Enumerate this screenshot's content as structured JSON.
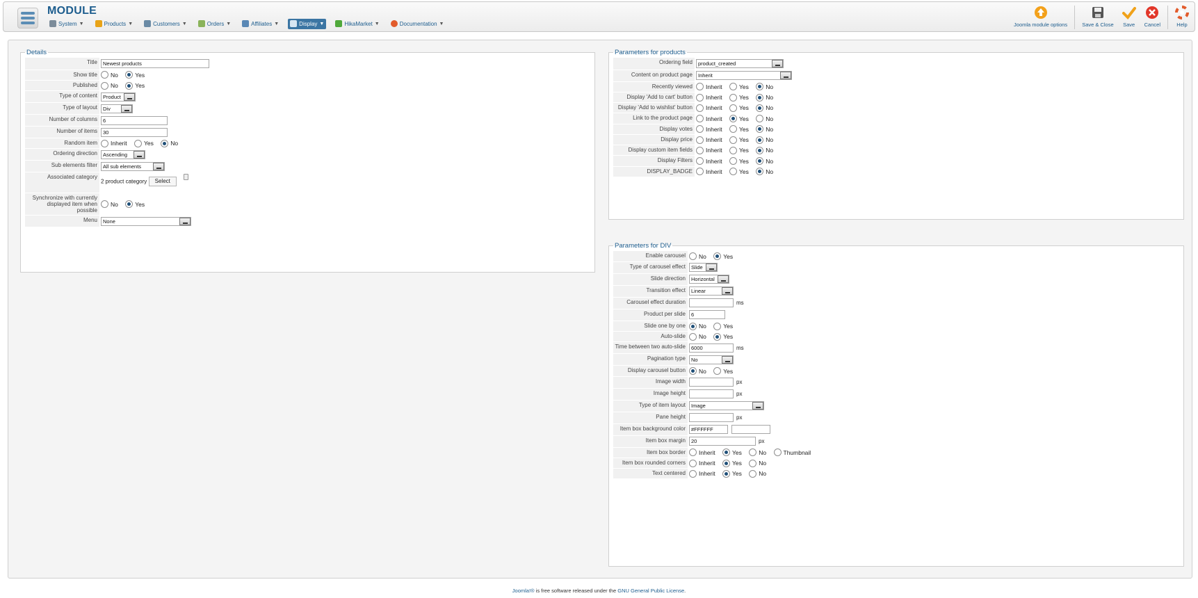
{
  "header": {
    "module_title": "MODULE",
    "menu": [
      {
        "label": "System",
        "icon": "wrench-icon",
        "color": "#7c8c9a"
      },
      {
        "label": "Products",
        "icon": "products-icon",
        "color": "#e8a317"
      },
      {
        "label": "Customers",
        "icon": "customers-icon",
        "color": "#6a8aa5"
      },
      {
        "label": "Orders",
        "icon": "orders-icon",
        "color": "#8ab35a"
      },
      {
        "label": "Affiliates",
        "icon": "affiliates-icon",
        "color": "#5a88b5"
      },
      {
        "label": "Display",
        "icon": "display-icon",
        "color": "#d8e6f2",
        "active": true
      },
      {
        "label": "HikaMarket",
        "icon": "hikamarket-icon",
        "color": "#4fa83a"
      },
      {
        "label": "Documentation",
        "icon": "lifebuoy-icon",
        "color": "#e25b2b"
      }
    ],
    "toolbar": {
      "joomla_options": "Joomla module options",
      "save_close": "Save & Close",
      "save": "Save",
      "cancel": "Cancel",
      "help": "Help"
    }
  },
  "details": {
    "legend": "Details",
    "title_label": "Title",
    "title_value": "Newest products",
    "show_title_label": "Show title",
    "published_label": "Published",
    "type_content_label": "Type of content",
    "type_content_value": "Product",
    "type_layout_label": "Type of layout",
    "type_layout_value": "Div",
    "num_columns_label": "Number of columns",
    "num_columns_value": "6",
    "num_items_label": "Number of items",
    "num_items_value": "30",
    "random_label": "Random item",
    "ordering_dir_label": "Ordering direction",
    "ordering_dir_value": "Ascending",
    "sub_filter_label": "Sub elements filter",
    "sub_filter_value": "All sub elements",
    "assoc_cat_label": "Associated category",
    "assoc_cat_value": "2 product category",
    "select_btn": "Select",
    "sync_label": "Synchronize with currently displayed item when possible",
    "menu_label": "Menu",
    "menu_value": "None"
  },
  "opts": {
    "no": "No",
    "yes": "Yes",
    "inherit": "Inherit",
    "thumbnail": "Thumbnail",
    "ms": "ms",
    "px": "px"
  },
  "products": {
    "legend": "Parameters for products",
    "ordering_field_label": "Ordering field",
    "ordering_field_value": "product_created",
    "content_page_label": "Content on product page",
    "content_page_value": "Inherit",
    "recently_viewed_label": "Recently viewed",
    "add_cart_label": "Display 'Add to cart' button",
    "add_wishlist_label": "Display 'Add to wishlist' button",
    "link_product_label": "Link to the product page",
    "votes_label": "Display votes",
    "price_label": "Display price",
    "custom_fields_label": "Display custom item fields",
    "filters_label": "Display Filters",
    "badge_label": "DISPLAY_BADGE"
  },
  "div": {
    "legend": "Parameters for DIV",
    "enable_carousel_label": "Enable carousel",
    "carousel_effect_label": "Type of carousel effect",
    "carousel_effect_value": "Slide",
    "slide_dir_label": "Slide direction",
    "slide_dir_value": "Horizontal",
    "transition_label": "Transition effect",
    "transition_value": "Linear",
    "duration_label": "Carousel effect duration",
    "duration_value": "",
    "per_slide_label": "Product per slide",
    "per_slide_value": "6",
    "one_by_one_label": "Slide one by one",
    "auto_slide_label": "Auto-slide",
    "time_between_label": "Time between two auto-slide",
    "time_between_value": "6000",
    "pagination_label": "Pagination type",
    "pagination_value": "No",
    "carousel_btn_label": "Display carousel button",
    "img_width_label": "Image width",
    "img_width_value": "",
    "img_height_label": "Image height",
    "img_height_value": "",
    "item_layout_label": "Type of item layout",
    "item_layout_value": "Image",
    "pane_height_label": "Pane height",
    "pane_height_value": "",
    "bg_color_label": "Item box background color",
    "bg_color_value": "#FFFFFF",
    "margin_label": "Item box margin",
    "margin_value": "20",
    "border_label": "Item box border",
    "rounded_label": "Item box rounded corners",
    "centered_label": "Text centered"
  },
  "footer": {
    "joomla_link": "Joomla!®",
    "text": " is free software released under the ",
    "license_link": "GNU General Public License",
    "end": "."
  }
}
